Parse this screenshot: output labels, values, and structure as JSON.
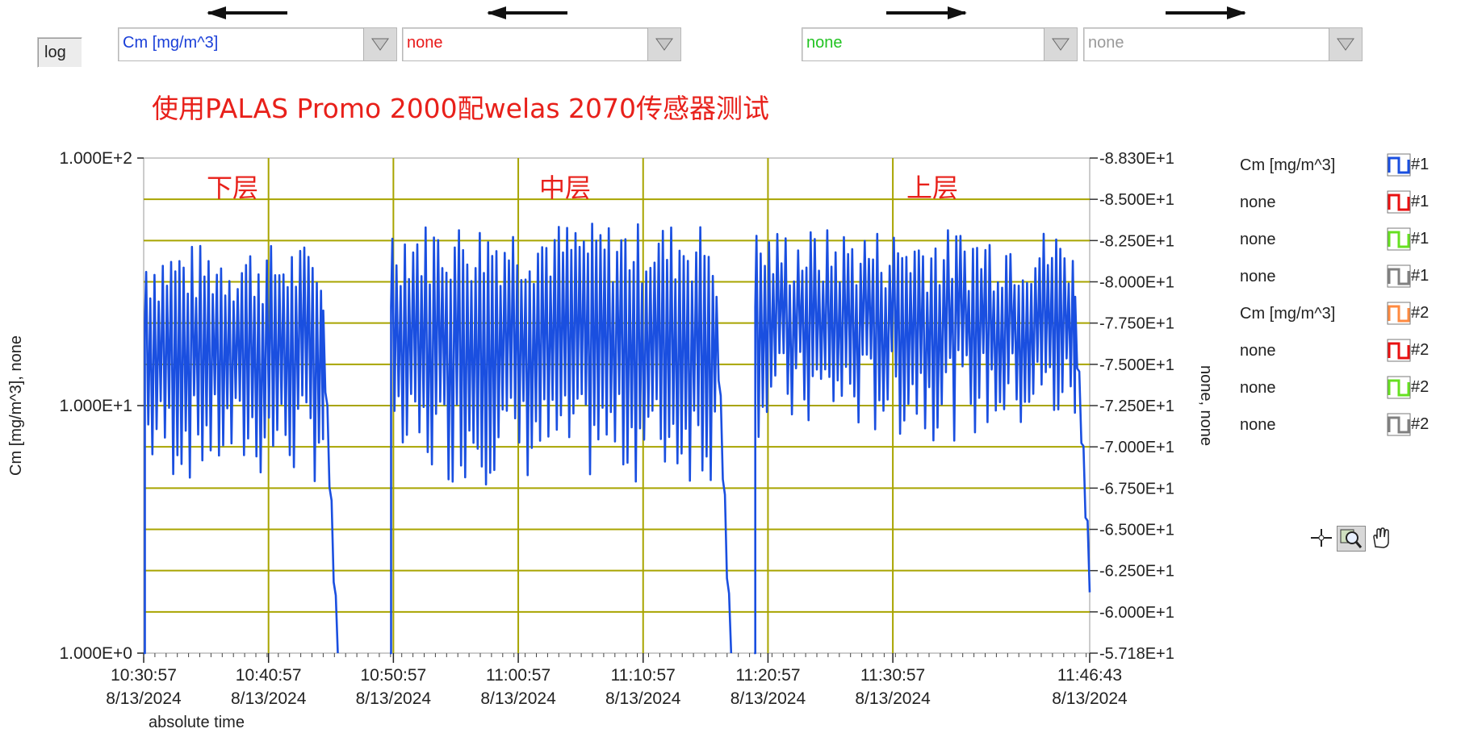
{
  "controls": {
    "log_label": "log",
    "combos": [
      {
        "value": "Cm [mg/m^3]",
        "color": "#1a3fd8"
      },
      {
        "value": "none",
        "color": "#e81a1a"
      },
      {
        "value": "none",
        "color": "#22c322"
      },
      {
        "value": "none",
        "color": "#9a9a9a"
      }
    ],
    "arrows": [
      "left",
      "left",
      "right",
      "right"
    ]
  },
  "title": "使用PALAS Promo 2000配welas 2070传感器测试",
  "legend": [
    {
      "label": "Cm [mg/m^3]",
      "suffix": "#1",
      "color": "#1a4fe0"
    },
    {
      "label": "none",
      "suffix": "#1",
      "color": "#e81010"
    },
    {
      "label": "none",
      "suffix": "#1",
      "color": "#66e020"
    },
    {
      "label": "none",
      "suffix": "#1",
      "color": "#808080"
    },
    {
      "label": "Cm [mg/m^3]",
      "suffix": "#2",
      "color": "#ff8a40"
    },
    {
      "label": "none",
      "suffix": "#2",
      "color": "#e81010"
    },
    {
      "label": "none",
      "suffix": "#2",
      "color": "#66e020"
    },
    {
      "label": "none",
      "suffix": "#2",
      "color": "#808080"
    }
  ],
  "tools": [
    "crosshair-icon",
    "zoom-icon",
    "pan-hand-icon"
  ],
  "chart_data": {
    "type": "line",
    "ylabel": "Cm [mg/m^3], none",
    "ylabel_right": "none, none",
    "xlabel": "absolute time",
    "y_scale": "log",
    "ylim": [
      1,
      100
    ],
    "y_ticks": [
      "1.000E+2",
      "1.000E+1",
      "1.000E+0"
    ],
    "y2lim": [
      57.18,
      88.3
    ],
    "y2_ticks": [
      "-8.830E+1",
      "-8.500E+1",
      "-8.250E+1",
      "-8.000E+1",
      "-7.750E+1",
      "-7.500E+1",
      "-7.250E+1",
      "-7.000E+1",
      "-6.750E+1",
      "-6.500E+1",
      "-6.250E+1",
      "-6.000E+1",
      "-5.718E+1"
    ],
    "x_ticks": [
      {
        "time": "10:30:57",
        "date": "8/13/2024"
      },
      {
        "time": "10:40:57",
        "date": "8/13/2024"
      },
      {
        "time": "10:50:57",
        "date": "8/13/2024"
      },
      {
        "time": "11:00:57",
        "date": "8/13/2024"
      },
      {
        "time": "11:10:57",
        "date": "8/13/2024"
      },
      {
        "time": "11:20:57",
        "date": "8/13/2024"
      },
      {
        "time": "11:30:57",
        "date": "8/13/2024"
      },
      {
        "time": "11:46:43",
        "date": "8/13/2024"
      }
    ],
    "zones": [
      "下层",
      "中层",
      "上层"
    ],
    "grid": true,
    "series": [
      {
        "name": "Cm [mg/m^3]",
        "color": "#1a4fe0",
        "segments": [
          {
            "start": "10:30:57",
            "end": "10:46:30",
            "low": 4,
            "high": 45,
            "tail_end": 1,
            "mean": 22
          },
          {
            "start": "10:50:40",
            "end": "11:18:00",
            "low": 4,
            "high": 55,
            "tail_end": 1,
            "mean": 25
          },
          {
            "start": "11:19:50",
            "end": "11:46:43",
            "low": 6,
            "high": 52,
            "tail_end": 2.2,
            "mean": 25
          }
        ]
      }
    ]
  }
}
